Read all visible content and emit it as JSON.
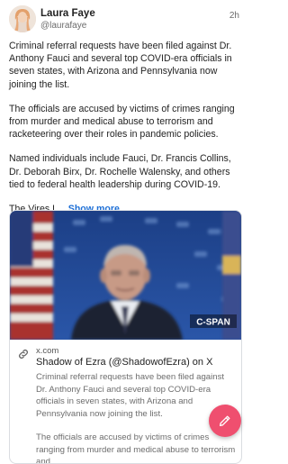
{
  "post": {
    "author_name": "Laura Faye",
    "author_handle": "@laurafaye",
    "time": "2h",
    "paragraphs": [
      "Criminal referral requests have been filed against Dr. Anthony Fauci and several top COVID-era officials in seven states, with Arizona and Pennsylvania now joining the list.",
      "The officials are accused by victims of crimes ranging from murder and medical abuse to terrorism and racketeering over their roles in pandemic policies.",
      "Named individuals include Fauci, Dr. Francis Collins, Dr. Deborah Birx, Dr. Rochelle Walensky, and others tied to federal health leadership during COVID-19."
    ],
    "truncated_text": "The Vires L...",
    "show_more_label": "Show more"
  },
  "link_card": {
    "image_watermark": "C-SPAN",
    "domain": "x.com",
    "title": "Shadow of Ezra (@ShadowofEzra) on X",
    "description_paragraphs": [
      "Criminal referral requests have been filed against Dr. Anthony Fauci and several top COVID-era officials in seven states, with Arizona and Pennsylvania now joining the list.",
      "The officials are accused by victims of crimes ranging from murder and medical abuse to terrorism and"
    ]
  },
  "icons": {
    "link": "link-icon",
    "compose": "pencil-icon"
  },
  "colors": {
    "accent_link": "#1d6fd6",
    "fab": "#ef4f6f"
  }
}
